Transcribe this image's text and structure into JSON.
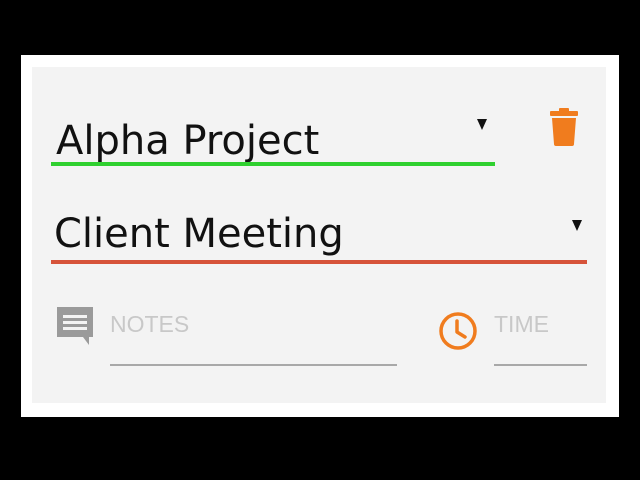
{
  "colors": {
    "background": "#000000",
    "card": "#f3f3f3",
    "project_accent": "#2fd02f",
    "activity_accent": "#d6533a",
    "action_orange": "#f07c1e",
    "notes_icon_gray": "#9a9a9a",
    "placeholder_gray": "#c8c8c8"
  },
  "project_select": {
    "value": "Alpha Project",
    "arrow_icon": "dropdown-triangle"
  },
  "activity_select": {
    "value": "Client Meeting",
    "arrow_icon": "dropdown-triangle"
  },
  "delete_button": {
    "icon": "trash-icon"
  },
  "notes": {
    "icon": "comment-icon",
    "placeholder": "NOTES"
  },
  "time": {
    "icon": "clock-icon",
    "placeholder": "TIME"
  }
}
